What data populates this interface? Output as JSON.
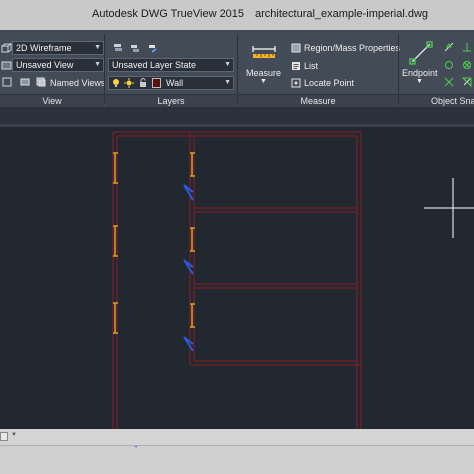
{
  "titlebar": {
    "app_title": "Autodesk DWG TrueView 2015",
    "file_name": "architectural_example-imperial.dwg"
  },
  "ribbon": {
    "view_panel": {
      "visual_style": "2D Wireframe",
      "saved_view": "Unsaved View",
      "named_views_label": "Named Views",
      "label": "View"
    },
    "layers_panel": {
      "layer_state": "Unsaved Layer State",
      "current_layer": "Wall",
      "layer_color": "#5a0f0f",
      "label": "Layers"
    },
    "measure_panel": {
      "measure_label": "Measure",
      "region_mass_label": "Region/Mass Properties",
      "list_label": "List",
      "locate_point_label": "Locate Point",
      "label": "Measure"
    },
    "osnap_panel": {
      "endpoint_label": "Endpoint",
      "label": "Object Snap"
    }
  },
  "canvas": {
    "background": "#212830",
    "wall_color": "#7a1f2b",
    "door_color": "#e0a020",
    "door_swing_color": "#2a58d8",
    "crosshair_color": "#ffffff"
  },
  "icons": {
    "visual_style": "wireframe-cube-icon",
    "saved_view": "view-icon",
    "named_views": "named-views-icon",
    "layer_bulb": "lightbulb-icon",
    "layer_sun": "sun-icon",
    "layer_lock": "lock-icon",
    "measure": "ruler-icon",
    "endpoint": "endpoint-snap-icon"
  }
}
